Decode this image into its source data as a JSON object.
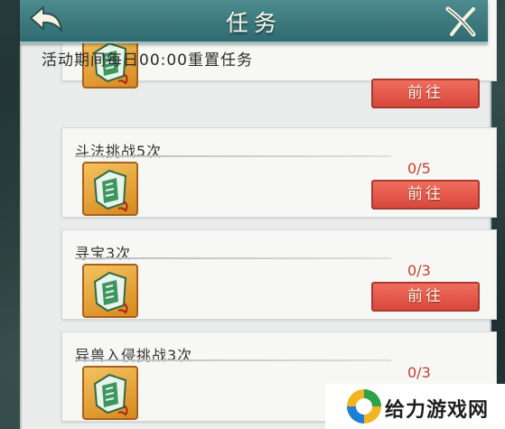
{
  "header": {
    "title": "任务"
  },
  "reset_notice": "活动期间每日00:00重置任务",
  "tasks": [
    {
      "name": "",
      "progress": "",
      "button_label": "前往"
    },
    {
      "name": "斗法挑战5次",
      "progress": "0/5",
      "button_label": "前往"
    },
    {
      "name": "寻宝3次",
      "progress": "0/3",
      "button_label": "前往"
    },
    {
      "name": "异兽入侵挑战3次",
      "progress": "0/3",
      "button_label": ""
    }
  ],
  "watermark": {
    "text": "给力游戏网"
  },
  "icons": {
    "back": "back-arrow-icon",
    "close": "close-icon",
    "reward": "jade-token-icon"
  },
  "colors": {
    "header": "#2f6a70",
    "button": "#e05447",
    "progress": "#c4402c",
    "reward_frame": "#e6a23c"
  }
}
